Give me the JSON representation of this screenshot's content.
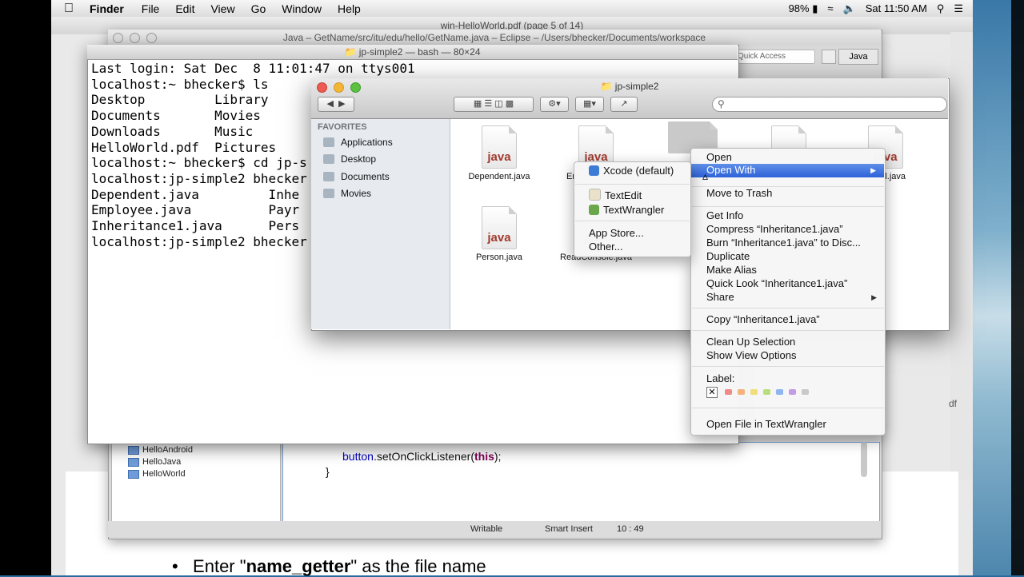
{
  "menubar": {
    "app_name": "Finder",
    "items": [
      "File",
      "Edit",
      "View",
      "Go",
      "Window",
      "Help"
    ],
    "battery": "98%",
    "clock": "Sat 11:50 AM"
  },
  "pdf": {
    "title": "win-HelloWorld.pdf (page 5 of 14)",
    "bullet_prefix": "Enter \"",
    "bullet_bold": "name_getter",
    "bullet_suffix": "\" as the file name",
    "side_label": "df"
  },
  "eclipse": {
    "title": "Java – GetName/src/itu/edu/hello/GetName.java – Eclipse – /Users/bhecker/Documents/workspace",
    "quick_access": "Quick Access",
    "perspective": "Java",
    "tree": [
      "HelloAndroid",
      "HelloJava",
      "HelloWorld"
    ],
    "code_obj": "button",
    "code_method": ".setOnClickListener(",
    "code_kw": "this",
    "code_end": ");",
    "code_brace": "}",
    "status": {
      "mode": "Writable",
      "insert": "Smart Insert",
      "position": "10 : 49"
    }
  },
  "terminal": {
    "title": "jp-simple2 — bash — 80×24",
    "lines": [
      "Last login: Sat Dec  8 11:01:47 on ttys001",
      "localhost:~ bhecker$ ls",
      "Desktop         Library",
      "Documents       Movies",
      "Downloads       Music",
      "HelloWorld.pdf  Pictures",
      "localhost:~ bhecker$ cd jp-s",
      "localhost:jp-simple2 bhecker",
      "Dependent.java         Inhe",
      "Employee.java          Payr",
      "Inheritance1.java      Pers",
      "localhost:jp-simple2 bhecker"
    ]
  },
  "finder": {
    "title": "jp-simple2",
    "favorites_heading": "FAVORITES",
    "sidebar": [
      "Applications",
      "Desktop",
      "Documents",
      "Movies"
    ],
    "file_badge": "java",
    "files": [
      {
        "name": "Dependent.java"
      },
      {
        "name": "Em"
      },
      {
        "name": ""
      },
      {
        "name": ""
      },
      {
        "name": "ll.java"
      },
      {
        "name": "Person.java"
      },
      {
        "name": "ReadConsole.java"
      }
    ]
  },
  "open_with_menu": {
    "items": [
      "Xcode (default)",
      "TextEdit",
      "TextWrangler",
      "App Store...",
      "Other..."
    ]
  },
  "context_menu": {
    "open": "Open",
    "open_with": "Open With",
    "move_to_trash": "Move to Trash",
    "get_info": "Get Info",
    "compress": "Compress “Inheritance1.java”",
    "burn": "Burn “Inheritance1.java” to Disc...",
    "duplicate": "Duplicate",
    "make_alias": "Make Alias",
    "quick_look": "Quick Look “Inheritance1.java”",
    "share": "Share",
    "copy": "Copy “Inheritance1.java”",
    "clean_up": "Clean Up Selection",
    "show_view_options": "Show View Options",
    "label": "Label:",
    "label_none": "✕",
    "label_colors": [
      "#ef8a8a",
      "#f3b37a",
      "#f1dd7b",
      "#b8df7a",
      "#8fb4f0",
      "#c39be6",
      "#c9c9c9"
    ],
    "open_in_tw": "Open File in TextWrangler"
  }
}
